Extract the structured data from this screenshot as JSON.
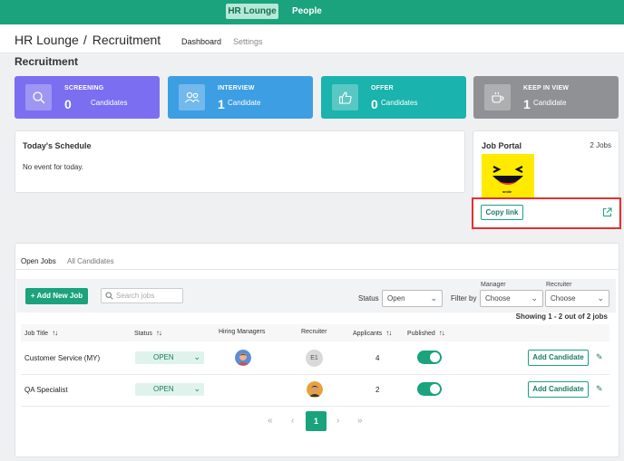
{
  "topnav": {
    "items": [
      "HR Lounge",
      "People"
    ]
  },
  "header": {
    "app": "HR Lounge",
    "separator": "/",
    "module": "Recruitment",
    "tabs": [
      "Dashboard",
      "Settings"
    ]
  },
  "page_title": "Recruitment",
  "stats": [
    {
      "label": "SCREENING",
      "count": "0",
      "unit": "Candidates",
      "color": "#7b6ef0",
      "icon": "search-icon"
    },
    {
      "label": "INTERVIEW",
      "count": "1",
      "unit": "Candidate",
      "color": "#3d9ee3",
      "icon": "people-icon"
    },
    {
      "label": "OFFER",
      "count": "0",
      "unit": "Candidates",
      "color": "#1ab3ad",
      "icon": "thumbs-up-icon"
    },
    {
      "label": "KEEP IN VIEW",
      "count": "1",
      "unit": "Candidate",
      "color": "#8f9194",
      "icon": "coffee-icon"
    }
  ],
  "schedule": {
    "title": "Today's Schedule",
    "empty": "No event for today."
  },
  "job_portal": {
    "title": "Job Portal",
    "jobs_count": "2 Jobs",
    "logo_caption": "smile",
    "copy_link": "Copy link"
  },
  "jobs": {
    "tabs": [
      "Open Jobs",
      "All Candidates"
    ],
    "add_button": "+ Add New Job",
    "search_placeholder": "Search jobs",
    "status_label": "Status",
    "status_value": "Open",
    "filter_by_label": "Filter by",
    "manager_label": "Manager",
    "manager_value": "Choose",
    "recruiter_label": "Recruiter",
    "recruiter_value": "Choose",
    "showing": "Showing 1 - 2 out of 2 jobs",
    "columns": [
      "Job Title",
      "Status",
      "Hiring Managers",
      "Recruiter",
      "Applicants",
      "Published"
    ],
    "rows": [
      {
        "title": "Customer Service (MY)",
        "status": "OPEN",
        "recruiter": "E1",
        "applicants": "4",
        "published": true,
        "action": "Add Candidate"
      },
      {
        "title": "QA Specialist",
        "status": "OPEN",
        "recruiter": "",
        "applicants": "2",
        "published": true,
        "action": "Add Candidate"
      }
    ],
    "pagination": {
      "first": "«",
      "prev": "‹",
      "current": "1",
      "next": "›",
      "last": "»"
    }
  },
  "colors": {
    "brand": "#1aa37d",
    "highlight": "#e03232"
  }
}
